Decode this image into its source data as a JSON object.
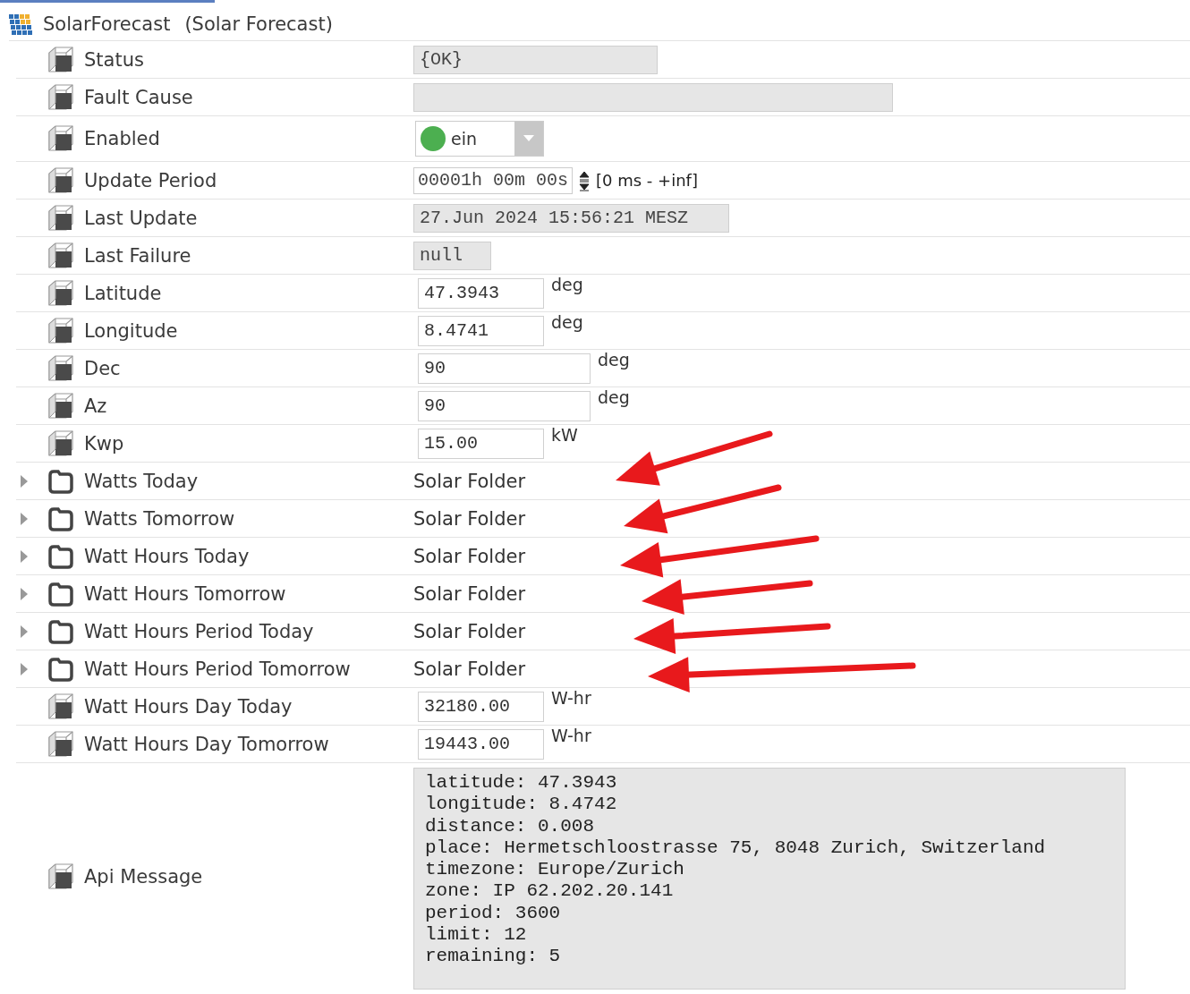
{
  "header": {
    "name": "SolarForecast",
    "display_name": "(Solar Forecast)"
  },
  "properties": [
    {
      "kind": "readonly",
      "label": "Status",
      "value": "{OK}"
    },
    {
      "kind": "readonly",
      "label": "Fault Cause"
    },
    {
      "kind": "toggle",
      "label": "Enabled",
      "value": "ein",
      "on": true
    },
    {
      "kind": "duration",
      "label": "Update Period",
      "value": "00001h 00m 00s",
      "range": "[0 ms - +inf]"
    },
    {
      "kind": "readonly",
      "label": "Last Update",
      "value": "27.Jun 2024 15:56:21 MESZ"
    },
    {
      "kind": "readonly",
      "label": "Last Failure",
      "value": "null"
    },
    {
      "kind": "number",
      "label": "Latitude",
      "value": "47.3943",
      "unit": "deg"
    },
    {
      "kind": "number",
      "label": "Longitude",
      "value": "8.4741",
      "unit": "deg"
    },
    {
      "kind": "number",
      "label": "Dec",
      "value": "90",
      "unit": "deg"
    },
    {
      "kind": "number",
      "label": "Az",
      "value": "90",
      "unit": "deg"
    },
    {
      "kind": "number",
      "label": "Kwp",
      "value": "15.00",
      "unit": "kW"
    },
    {
      "kind": "folder",
      "label": "Watts Today",
      "value": "Solar Folder",
      "expanded": false,
      "marked": true
    },
    {
      "kind": "folder",
      "label": "Watts Tomorrow",
      "value": "Solar Folder",
      "expanded": false,
      "marked": true
    },
    {
      "kind": "folder",
      "label": "Watt Hours Today",
      "value": "Solar Folder",
      "expanded": false,
      "marked": true
    },
    {
      "kind": "folder",
      "label": "Watt Hours Tomorrow",
      "value": "Solar Folder",
      "expanded": false,
      "marked": true
    },
    {
      "kind": "folder",
      "label": "Watt Hours Period Today",
      "value": "Solar Folder",
      "expanded": false,
      "marked": true
    },
    {
      "kind": "folder",
      "label": "Watt Hours Period Tomorrow",
      "value": "Solar Folder",
      "expanded": false,
      "marked": true
    },
    {
      "kind": "number",
      "label": "Watt Hours Day Today",
      "value": "32180.00",
      "unit": "W-hr"
    },
    {
      "kind": "number",
      "label": "Watt Hours Day Tomorrow",
      "value": "19443.00",
      "unit": "W-hr"
    },
    {
      "kind": "textarea",
      "label": "Api Message",
      "lines": [
        "latitude: 47.3943",
        "longitude: 8.4742",
        "distance: 0.008",
        "place: Hermetschloostrasse 75, 8048 Zurich, Switzerland",
        "timezone: Europe/Zurich",
        "zone: IP 62.202.20.141",
        "period: 3600",
        "limit: 12",
        "remaining: 5"
      ]
    }
  ]
}
